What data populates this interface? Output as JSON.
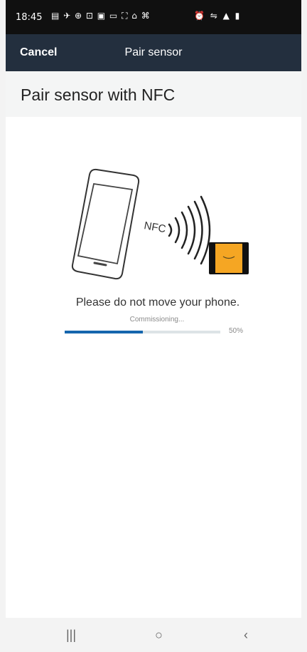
{
  "status_bar": {
    "time": "18:45",
    "left_icons": "▤ ✈ ⊕ ⊡ ▣ ▭ ⛶ ⌂ ⌘",
    "right_icons": "⏰ ⇋ ▲ ▮"
  },
  "app_bar": {
    "cancel_label": "Cancel",
    "title": "Pair sensor"
  },
  "page": {
    "title": "Pair sensor with NFC"
  },
  "illustration": {
    "nfc_label": "NFC"
  },
  "progress": {
    "message": "Please do not move your phone.",
    "status": "Commissioning...",
    "percent_label": "50%",
    "value": 0.5
  },
  "nav_bar": {
    "recents": "|||",
    "home": "○",
    "back": "‹"
  },
  "colors": {
    "app_bar": "#232f3e",
    "progress_fill": "#1566ad",
    "sensor_orange": "#f5a623"
  }
}
